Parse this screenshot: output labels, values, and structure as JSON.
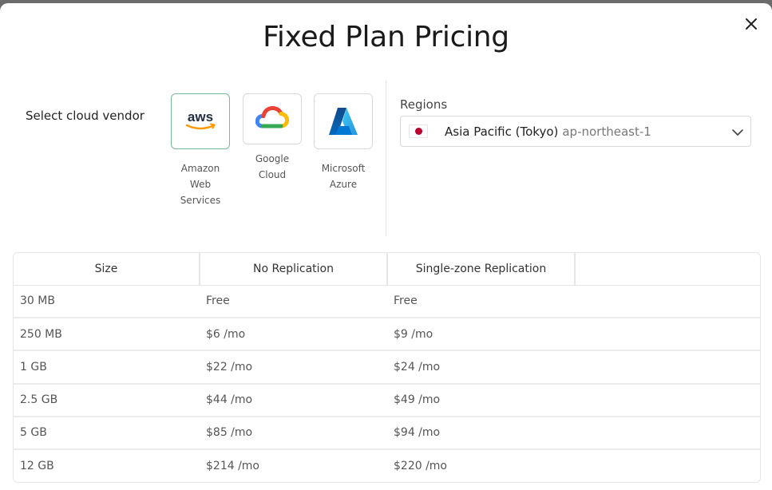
{
  "dialog": {
    "title": "Fixed Plan Pricing",
    "close_icon": "close-icon"
  },
  "vendor_select": {
    "label": "Select cloud vendor",
    "selected": "aws",
    "vendors": [
      {
        "id": "aws",
        "logo_text": "aws",
        "icon": "aws-logo-icon",
        "name_lines": [
          "Amazon",
          "Web",
          "Services"
        ]
      },
      {
        "id": "google",
        "icon": "google-cloud-logo-icon",
        "name_lines": [
          "Google",
          "Cloud"
        ]
      },
      {
        "id": "azure",
        "icon": "microsoft-azure-logo-icon",
        "name_lines": [
          "Microsoft",
          "Azure"
        ]
      }
    ]
  },
  "regions": {
    "label": "Regions",
    "selected_name": "Asia Pacific (Tokyo)",
    "selected_code": "ap-northeast-1",
    "flag_icon": "japan-flag-icon",
    "dropdown_icon": "chevron-down-icon"
  },
  "pricing_table": {
    "headers": [
      "Size",
      "No Replication",
      "Single-zone Replication",
      ""
    ],
    "rows": [
      [
        "30 MB",
        "Free",
        "Free",
        ""
      ],
      [
        "250 MB",
        "$6 /mo",
        "$9 /mo",
        ""
      ],
      [
        "1 GB",
        "$22 /mo",
        "$24 /mo",
        ""
      ],
      [
        "2.5 GB",
        "$44 /mo",
        "$49 /mo",
        ""
      ],
      [
        "5 GB",
        "$85 /mo",
        "$94 /mo",
        ""
      ],
      [
        "12 GB",
        "$214 /mo",
        "$220 /mo",
        ""
      ]
    ]
  },
  "colors": {
    "selected_border": "#7ab89a",
    "aws_orange": "#ff9900",
    "japan_red": "#bc002d",
    "backdrop": "#6b6b6b"
  }
}
